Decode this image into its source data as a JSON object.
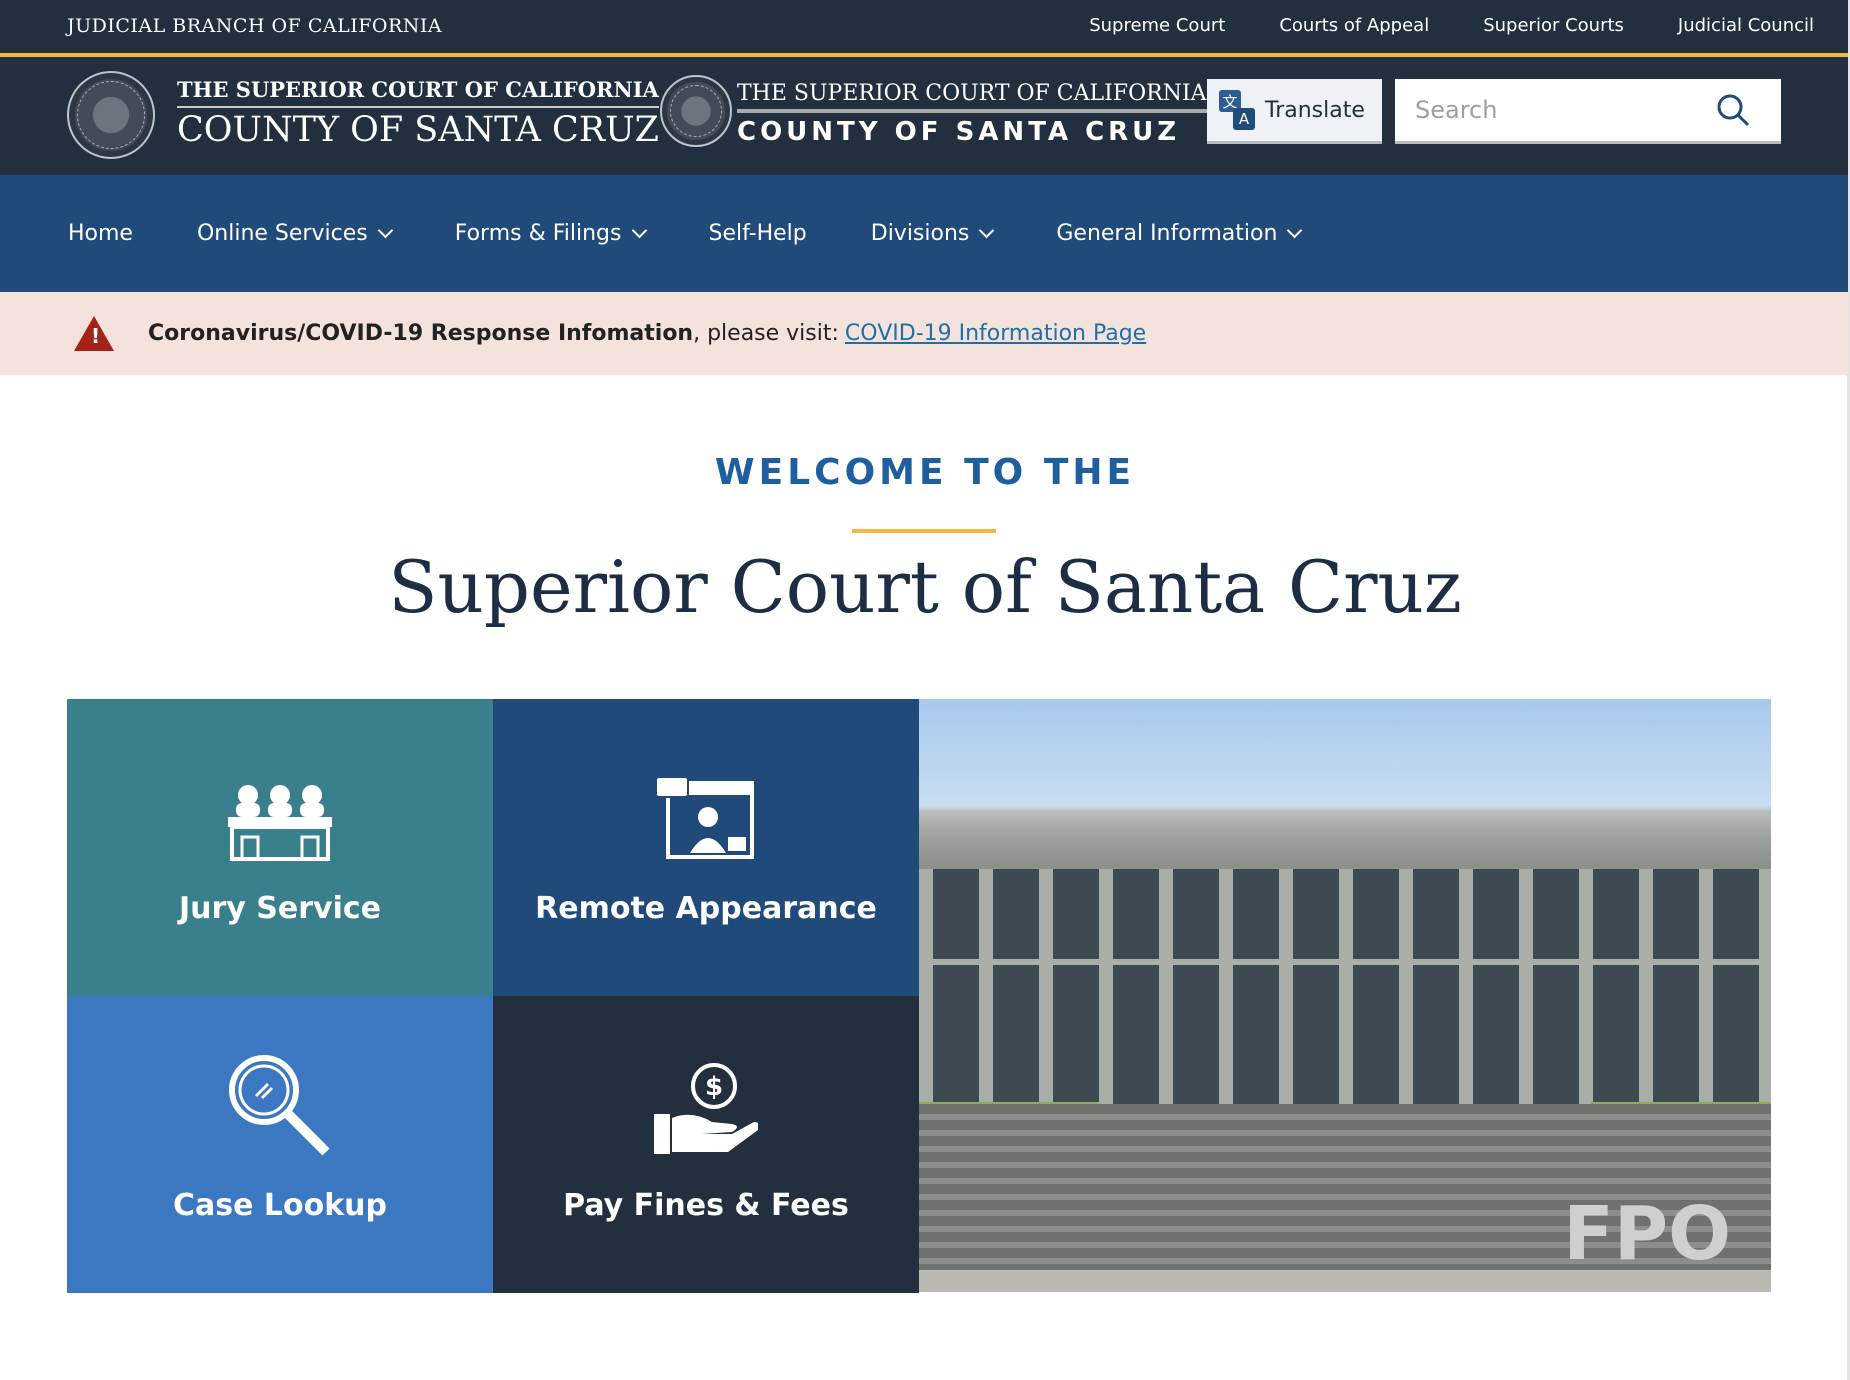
{
  "topbar": {
    "brand": "JUDICIAL BRANCH OF CALIFORNIA",
    "links": [
      "Supreme Court",
      "Courts of Appeal",
      "Superior Courts",
      "Judicial Council"
    ]
  },
  "header": {
    "logo1": {
      "line1": "THE SUPERIOR COURT OF CALIFORNIA",
      "line2": "COUNTY OF SANTA CRUZ"
    },
    "logo2": {
      "line1": "THE SUPERIOR COURT OF CALIFORNIA",
      "line2": "COUNTY OF SANTA CRUZ"
    },
    "translate_label": "Translate",
    "search_placeholder": "Search"
  },
  "nav": {
    "items": [
      {
        "label": "Home"
      },
      {
        "label": "Online Services"
      },
      {
        "label": "Forms & Filings"
      },
      {
        "label": "Self-Help"
      },
      {
        "label": "Divisions"
      },
      {
        "label": "General Information"
      }
    ]
  },
  "alert": {
    "bold": "Coronavirus/COVID-19 Response Infomation",
    "text": ", please visit:",
    "link": "COVID-19 Information Page"
  },
  "hero": {
    "kicker": "WELCOME TO THE",
    "title": "Superior Court of Santa Cruz"
  },
  "tiles": [
    {
      "label": "Jury Service",
      "color": "#3a7f8c"
    },
    {
      "label": "Remote Appearance",
      "color": "#1f4a7a"
    },
    {
      "label": "Case Lookup",
      "color": "#3b78c1"
    },
    {
      "label": "Pay Fines & Fees",
      "color": "#222f3e"
    }
  ],
  "photo": {
    "watermark": "FPO"
  }
}
